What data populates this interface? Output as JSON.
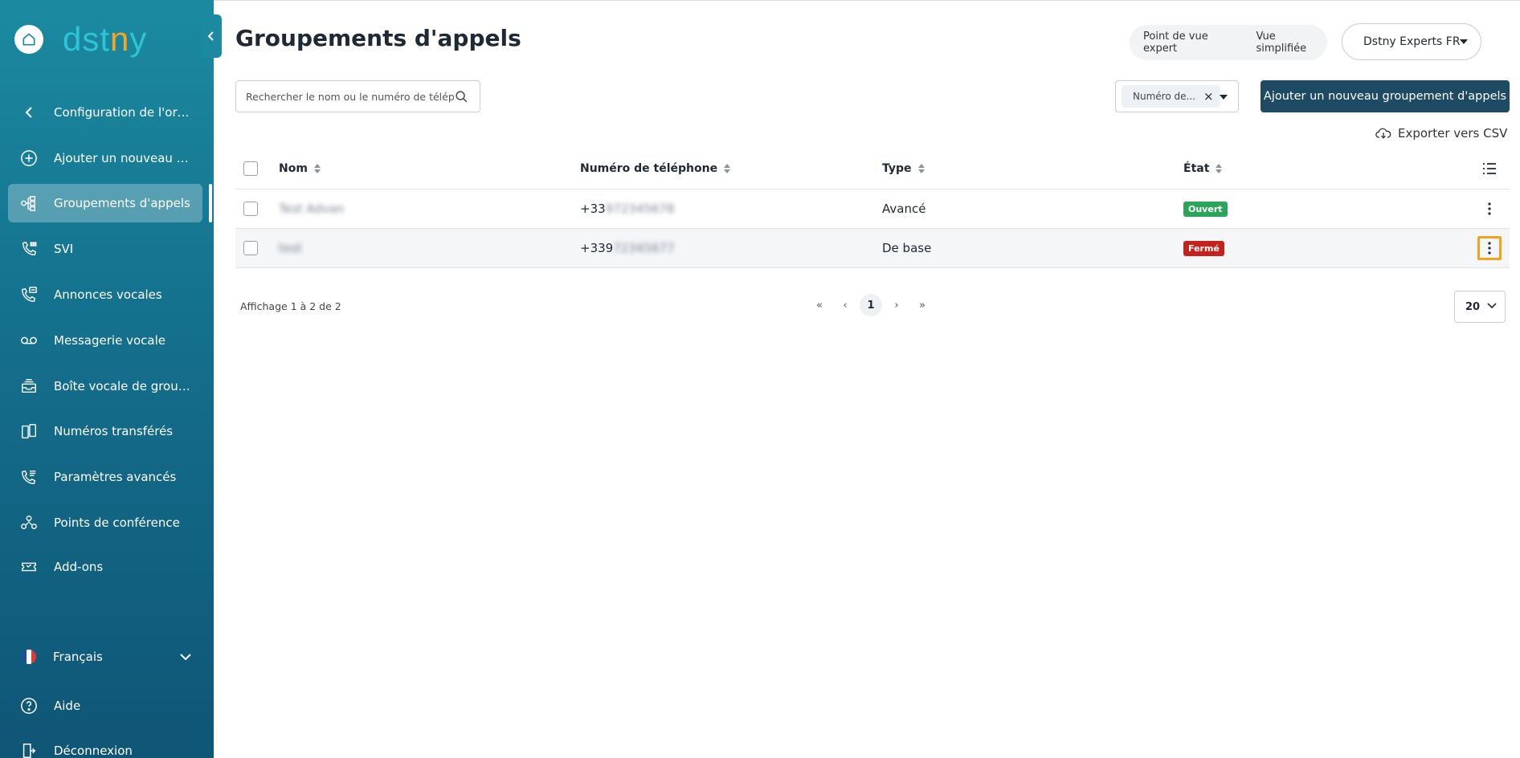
{
  "app": {
    "logo_text_a": "dst",
    "logo_text_dot": "n",
    "logo_text_b": "y"
  },
  "sidebar": {
    "back_label": "Configuration de l'org...",
    "items": [
      {
        "label": "Ajouter un nouveau cli...",
        "icon": "plus-circle-icon"
      },
      {
        "label": "Groupements d'appels",
        "icon": "call-group-icon"
      },
      {
        "label": "SVI",
        "icon": "ivr-phone-icon"
      },
      {
        "label": "Annonces vocales",
        "icon": "voice-announcement-icon"
      },
      {
        "label": "Messagerie vocale",
        "icon": "voicemail-icon"
      },
      {
        "label": "Boîte vocale de groupe",
        "icon": "group-mailbox-icon"
      },
      {
        "label": "Numéros transférés",
        "icon": "transferred-numbers-icon"
      },
      {
        "label": "Paramètres avancés",
        "icon": "advanced-settings-icon"
      },
      {
        "label": "Points de conférence",
        "icon": "conference-icon"
      },
      {
        "label": "Add-ons",
        "icon": "addons-ticket-icon"
      }
    ],
    "language": "Français",
    "help": "Aide",
    "logout": "Déconnexion"
  },
  "header": {
    "title": "Groupements d'appels",
    "view_expert": "Point de vue expert",
    "view_simple": "Vue simplifiée",
    "org": "Dstny Experts FR"
  },
  "toolbar": {
    "search_placeholder": "Rechercher le nom ou le numéro de téléphone",
    "filter_chip": "Numéro de...",
    "filter_clear": "×",
    "add_button": "Ajouter un nouveau groupement d'appels",
    "export": "Exporter vers CSV"
  },
  "table": {
    "columns": [
      "Nom",
      "Numéro de téléphone",
      "Type",
      "État"
    ],
    "rows": [
      {
        "name": "Test Advan",
        "phone_visible": "+33",
        "phone_hidden": "972345678",
        "type": "Avancé",
        "state": "Ouvert",
        "state_color": "#2aa65a"
      },
      {
        "name": "test",
        "phone_visible": "+339",
        "phone_hidden": "72345677",
        "type": "De base",
        "state": "Fermé",
        "state_color": "#c8211c"
      }
    ]
  },
  "pagination": {
    "info": "Affichage 1 à 2 de 2",
    "first": "«",
    "prev": "‹",
    "current": "1",
    "next": "›",
    "last": "»",
    "per_page": "20"
  },
  "colors": {
    "accent_button": "#1f4a64",
    "highlight": "#f5a21c",
    "sidebar_top": "#1b8aa0",
    "sidebar_bottom": "#0f5576"
  }
}
